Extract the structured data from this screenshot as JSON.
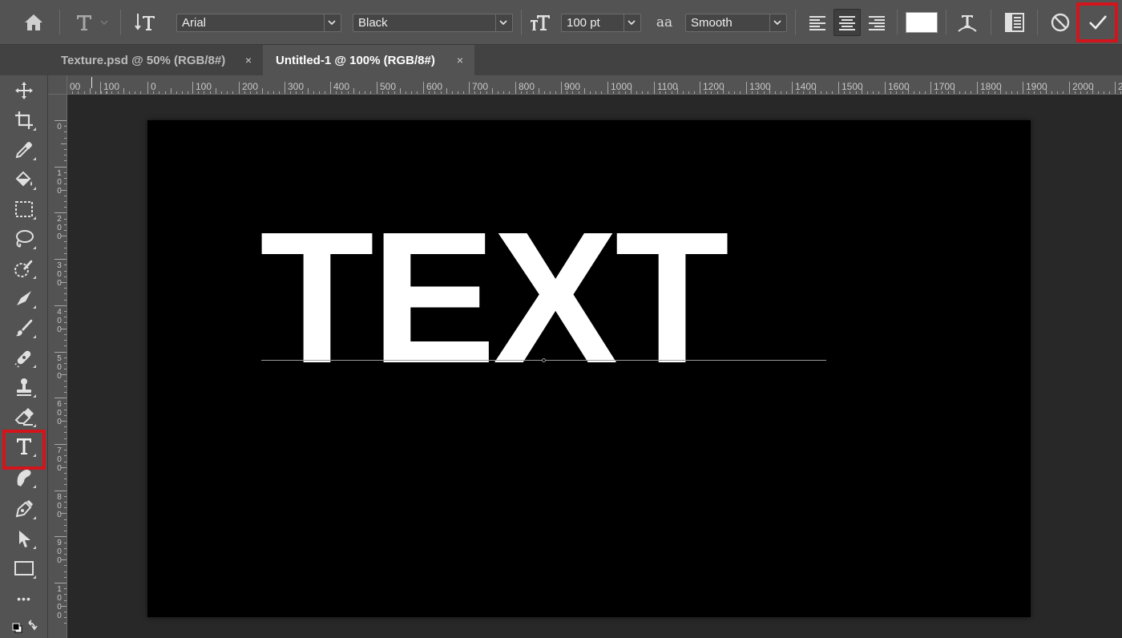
{
  "options_bar": {
    "font_family": "Arial",
    "font_style": "Black",
    "font_size": "100 pt",
    "antialias": "Smooth",
    "antialias_icon_text": "aa",
    "text_color": "#ffffff"
  },
  "tabs": [
    {
      "label": "Texture.psd @ 50% (RGB/8#)",
      "close": "×",
      "active": false
    },
    {
      "label": "Untitled-1 @ 100% (RGB/8#)",
      "close": "×",
      "active": true
    }
  ],
  "panel_collapse": "»",
  "ruler_h_labels": [
    "00",
    "100",
    "0",
    "100",
    "200",
    "300",
    "400",
    "500",
    "600",
    "700",
    "800",
    "900",
    "1000",
    "1100",
    "1200",
    "1300",
    "1400",
    "1500",
    "1600",
    "1700",
    "1800",
    "1900",
    "2000",
    "2"
  ],
  "ruler_v_labels": [
    "0",
    "1\n0\n0",
    "2\n0\n0",
    "3\n0\n0",
    "4\n0\n0",
    "5\n0\n0",
    "6\n0\n0",
    "7\n0\n0",
    "8\n0\n0",
    "9\n0\n0",
    "1\n0\n0\n0"
  ],
  "canvas": {
    "text": "TEXT",
    "background": "#000000",
    "text_color": "#ffffff"
  },
  "toolbar": {
    "more_tools": "•••",
    "active_tool": "type-tool"
  },
  "highlight_color": "#d2141c"
}
